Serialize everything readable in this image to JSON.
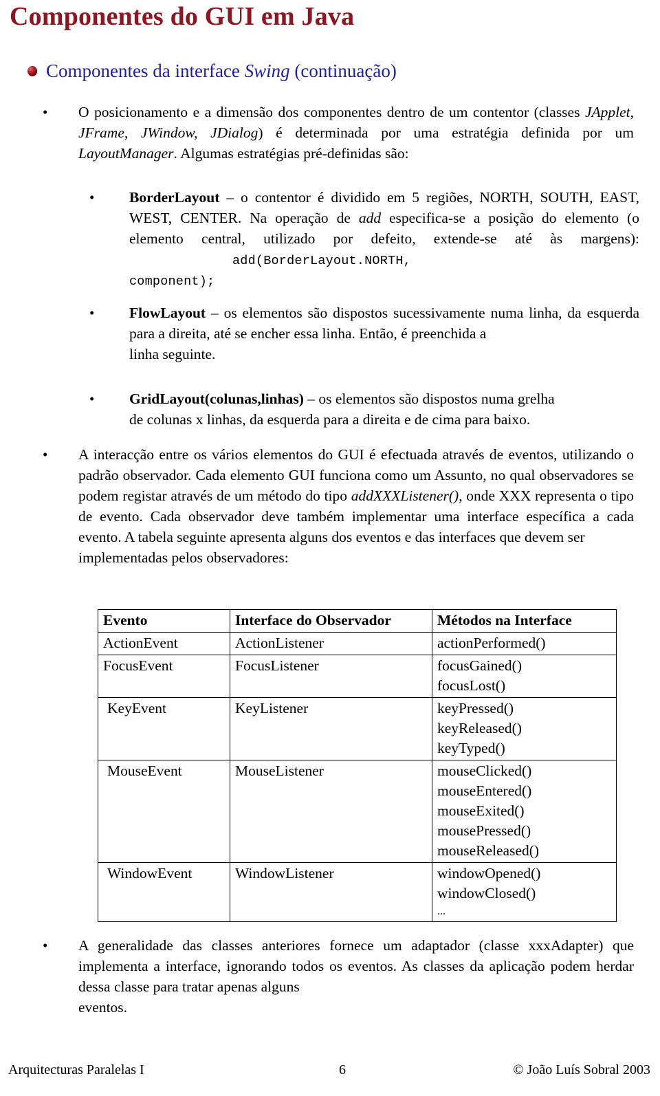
{
  "slide": {
    "title": "Componentes do GUI em Java",
    "subtitle_pre": "Componentes da interface ",
    "subtitle_em": "Swing",
    "subtitle_post": " (continuação)",
    "bullet_icon": "red-sphere-bullet-icon",
    "title_color": "#8e1621",
    "subtitle_color": "#1f1fa6"
  },
  "content": {
    "b1": {
      "marker": "•",
      "part1": "O posicionamento e a dimensão dos componentes dentro de um contentor (classes ",
      "em1": "JApplet, JFrame, JWindow, JDialog",
      "part2": ") é determinada por uma estratégia definida por um ",
      "em2": "LayoutManager",
      "part3": ". Algumas estratégias pré-definidas são:"
    },
    "b2": {
      "marker": "•",
      "strong": "BorderLayout",
      "part1": " – o contentor é dividido em 5 regiões, NORTH, SOUTH, EAST, WEST, CENTER. Na operação de ",
      "em1": "add",
      "part2": " especifica-se a posição do elemento (o elemento central, utilizado por defeito, extende-se até às margens):",
      "code1": "add(BorderLayout.NORTH,",
      "code2": "component);"
    },
    "b3": {
      "marker": "•",
      "strong": "FlowLayout",
      "part1": " – os elementos são dispostos sucessivamente numa linha, da esquerda para a direita, até se encher essa linha. Então, é preenchida a ",
      "tail": "linha seguinte."
    },
    "b4": {
      "marker": "•",
      "strong": "GridLayout(colunas,linhas)",
      "part1": " – os elementos são dispostos numa grelha ",
      "tail": "de colunas x linhas, da esquerda para a direita e de cima para baixo."
    },
    "b5": {
      "marker": "•",
      "part1": "A interacção entre os vários elementos do GUI é efectuada através de eventos, utilizando o padrão observador. Cada elemento GUI funciona como um Assunto, no qual observadores se podem registar através de um método do tipo ",
      "em1": "addXXXListener()",
      "part2": ", onde XXX representa o tipo de evento. Cada observador deve também implementar uma interface específica a cada evento. A tabela seguinte apresenta alguns dos eventos e das interfaces que devem ser ",
      "tail": "implementadas pelos observadores:"
    },
    "b6": {
      "marker": "•",
      "part1": "A generalidade das classes anteriores fornece um adaptador (classe xxxAdapter) que implementa a interface, ignorando todos os eventos. As classes da aplicação podem herdar dessa classe para tratar apenas alguns ",
      "tail": "eventos."
    }
  },
  "table": {
    "headers": [
      "Evento",
      "Interface do Observador",
      "Métodos na Interface"
    ],
    "rows": [
      {
        "event": "ActionEvent",
        "interface": "ActionListener",
        "methods": [
          "actionPerformed()"
        ],
        "indent": false,
        "ellipsis": false
      },
      {
        "event": "FocusEvent",
        "interface": "FocusListener",
        "methods": [
          "focusGained()",
          "focusLost()"
        ],
        "indent": false,
        "ellipsis": false
      },
      {
        "event": "KeyEvent",
        "interface": "KeyListener",
        "methods": [
          "keyPressed()",
          "keyReleased()",
          "keyTyped()"
        ],
        "indent": true,
        "ellipsis": false
      },
      {
        "event": "MouseEvent",
        "interface": "MouseListener",
        "methods": [
          "mouseClicked()",
          "mouseEntered()",
          "mouseExited()",
          "mousePressed()",
          "mouseReleased()"
        ],
        "indent": true,
        "ellipsis": false
      },
      {
        "event": "WindowEvent",
        "interface": "WindowListener",
        "methods": [
          "windowOpened()",
          "windowClosed()"
        ],
        "indent": true,
        "ellipsis": true,
        "ellipsis_text": "..."
      }
    ]
  },
  "footer": {
    "left": "Arquitecturas Paralelas I",
    "page": "6",
    "right": "© João Luís Sobral 2003"
  }
}
